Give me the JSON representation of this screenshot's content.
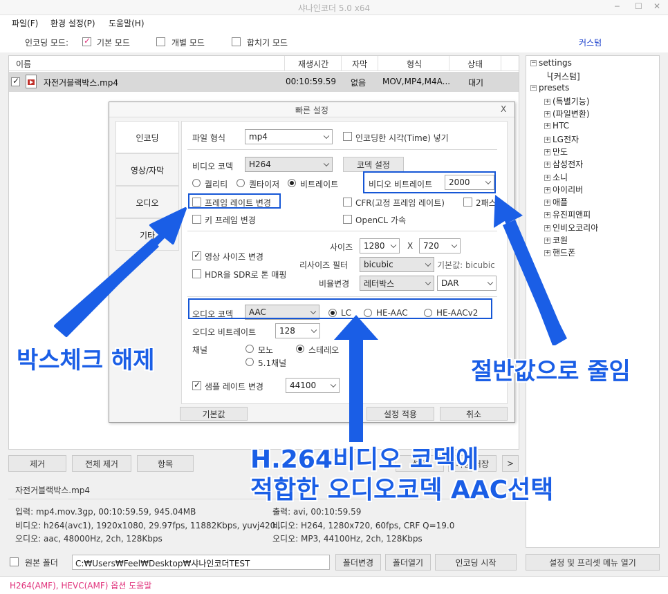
{
  "window": {
    "title": "샤나인코더 5.0 x64",
    "minimize": "─",
    "maximize": "☐",
    "close": "✕"
  },
  "menu": [
    "파일(F)",
    "환경 설정(P)",
    "도움말(H)"
  ],
  "mode": {
    "label": "인코딩 모드:",
    "basic": "기본 모드",
    "individual": "개별 모드",
    "merge": "합치기 모드",
    "custom_link": "커스텀"
  },
  "file_table": {
    "headers": {
      "name": "이름",
      "duration": "재생시간",
      "subtitle": "자막",
      "format": "형식",
      "status": "상태"
    },
    "row": {
      "name": "자전거블랙박스.mp4",
      "duration": "00:10:59.59",
      "subtitle": "없음",
      "format": "MOV,MP4,M4A...",
      "status": "대기"
    }
  },
  "tree": {
    "settings": "settings",
    "custom": "[커스텀]",
    "presets": "presets",
    "items": [
      "(특별기능)",
      "(파일변환)",
      "HTC",
      "LG전자",
      "만도",
      "삼성전자",
      "소니",
      "아이리버",
      "애플",
      "유진피앤피",
      "인비오코리아",
      "코원",
      "핸드폰"
    ]
  },
  "dialog": {
    "title": "빠른 설정",
    "close": "X",
    "tabs": [
      "인코딩",
      "영상/자막",
      "오디오",
      "기타"
    ],
    "file_format_label": "파일 형식",
    "file_format_value": "mp4",
    "insert_time": "인코딩한 시각(Time) 넣기",
    "video_codec_label": "비디오 코덱",
    "video_codec_value": "H264",
    "codec_settings_btn": "코덱 설정",
    "rc_quality": "퀄리티",
    "rc_quantizer": "퀀타이저",
    "rc_bitrate": "비트레이트",
    "video_bitrate_label": "비디오 비트레이트",
    "video_bitrate_value": "2000",
    "frame_rate_change": "프레임 레이트 변경",
    "cfr": "CFR(고정 프레임 레이트)",
    "two_pass": "2패스",
    "keyframe_change": "키 프레임 변경",
    "opencl": "OpenCL 가속",
    "size_change": "영상 사이즈 변경",
    "size_label": "사이즈",
    "width": "1280",
    "x": "X",
    "height": "720",
    "hdr": "HDR을 SDR로 톤 매핑",
    "resize_filter_label": "리사이즈 필터",
    "resize_filter_value": "bicubic",
    "resize_default": "기본값: bicubic",
    "ratio_label": "비율변경",
    "ratio_value": "레터박스",
    "ratio_mode": "DAR",
    "audio_codec_label": "오디오 코덱",
    "audio_codec_value": "AAC",
    "aac_lc": "LC",
    "aac_he": "HE-AAC",
    "aac_hev2": "HE-AACv2",
    "audio_bitrate_label": "오디오 비트레이트",
    "audio_bitrate_value": "128",
    "channel_label": "채널",
    "mono": "모노",
    "stereo": "스테레오",
    "ch51": "5.1채널",
    "sample_rate_change": "샘플 레이트 변경",
    "sample_rate_value": "44100",
    "default_btn": "기본값",
    "apply_btn": "설정 적용",
    "cancel_btn": "취소"
  },
  "bottom_buttons": {
    "remove": "제거",
    "remove_all": "전체 제거",
    "items": "항목",
    "set": "설정",
    "save": "파일 저장",
    "more": ">"
  },
  "info": {
    "filename": "자전거블랙박스.mp4",
    "input": "입력: mp4.mov.3gp, 00:10:59.59, 945.04MB",
    "input_video": "비디오: h264(avc1), 1920x1080, 29.97fps, 11882Kbps,  yuvj420...",
    "input_audio": "오디오: aac, 48000Hz, 2ch, 128Kbps",
    "output": "출력: avi, 00:10:59.59",
    "output_video": "비디오: H264, 1280x720, 60fps, CRF Q=19.0",
    "output_audio": "오디오: MP3, 44100Hz, 2ch, 128Kbps"
  },
  "footer": {
    "original_folder": "원본 폴더",
    "path": "C:₩Users₩Feel₩Desktop₩샤나인코더TEST",
    "change_folder": "폴더변경",
    "open_folder": "폴더열기",
    "start": "인코딩 시작",
    "preset_menu": "설정 및 프리셋 메뉴 열기",
    "help_link": "H264(AMF), HEVC(AMF) 옵션 도움말"
  },
  "annotations": {
    "uncheck": "박스체크 해제",
    "half": "절반값으로 줄임",
    "aac_line1": "H.264비디오 코덱에",
    "aac_line2": "적합한 오디오코덱 AAC선택"
  },
  "colors": {
    "annotation": "#1a5ee6",
    "accent_pink": "#e0307a",
    "link": "#1a3fcc",
    "dialog_bg": "#f4f4f4"
  }
}
